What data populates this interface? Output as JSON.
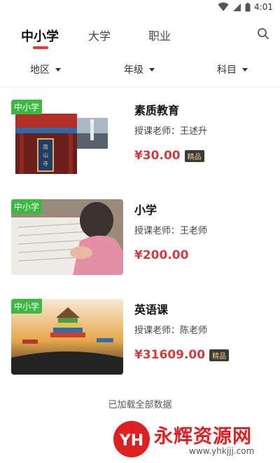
{
  "status_bar": {
    "time": "4:01"
  },
  "tabs": [
    {
      "label": "中小学",
      "active": true
    },
    {
      "label": "大学",
      "active": false
    },
    {
      "label": "职业",
      "active": false
    }
  ],
  "filters": [
    {
      "label": "地区"
    },
    {
      "label": "年级"
    },
    {
      "label": "科目"
    }
  ],
  "courses": [
    {
      "badge": "中小学",
      "title": "素质教育",
      "teacher": "授课老师：王述升",
      "price": "¥30.00",
      "tag": "精品"
    },
    {
      "badge": "中小学",
      "title": "小学",
      "teacher": "授课老师：王老师",
      "price": "¥200.00",
      "tag": ""
    },
    {
      "badge": "中小学",
      "title": "英语课",
      "teacher": "授课老师：陈老师",
      "price": "¥31609.00",
      "tag": "精品"
    }
  ],
  "footer": {
    "loaded_text": "已加载全部数据"
  },
  "watermark": {
    "logo_text": "YH",
    "text": "永辉资源网",
    "url": "www.yhkjjj.com"
  },
  "colors": {
    "accent": "#e53935",
    "badge_green": "#3cb943",
    "price_red": "#d23b3b"
  }
}
